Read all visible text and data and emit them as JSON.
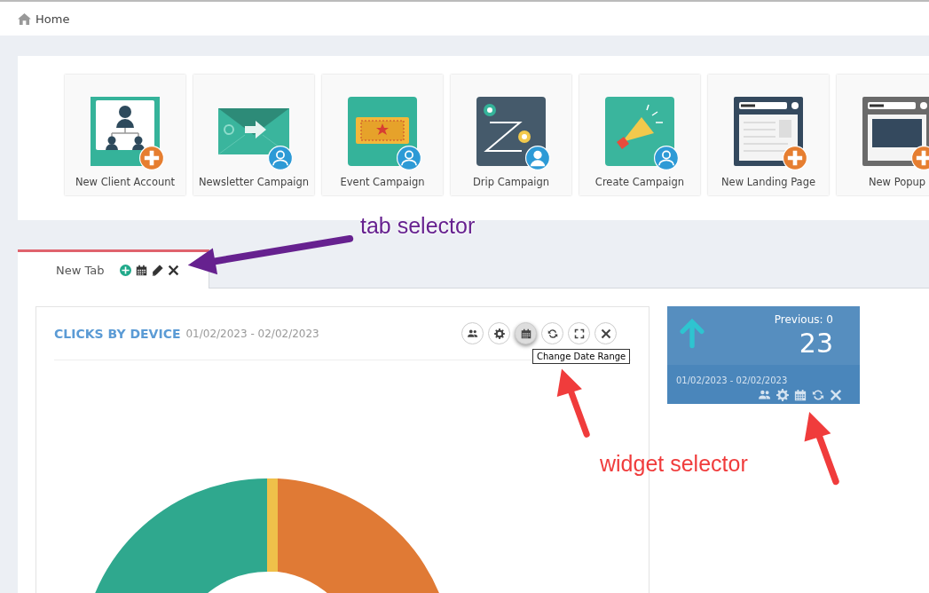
{
  "breadcrumb": {
    "label": "Home"
  },
  "shortcuts": [
    {
      "label": "New Client Account"
    },
    {
      "label": "Newsletter Campaign"
    },
    {
      "label": "Event Campaign"
    },
    {
      "label": "Drip Campaign"
    },
    {
      "label": "Create Campaign"
    },
    {
      "label": "New Landing Page"
    },
    {
      "label": "New Popup"
    }
  ],
  "tabs": [
    {
      "label": "New Tab",
      "selected": true
    }
  ],
  "chart_widget": {
    "title": "CLICKS BY DEVICE",
    "date_range": "01/02/2023 - 02/02/2023",
    "buttons": [
      {
        "kind": "users",
        "selected": false
      },
      {
        "kind": "settings",
        "selected": false
      },
      {
        "kind": "calendar",
        "selected": true
      },
      {
        "kind": "refresh",
        "selected": false
      },
      {
        "kind": "expand",
        "selected": false
      },
      {
        "kind": "close",
        "selected": false
      }
    ],
    "tooltip": "Change Date Range"
  },
  "stat_widget": {
    "previous": "Previous: 0",
    "value": "23",
    "date_range": "01/02/2023 - 02/02/2023"
  },
  "annotations": [
    {
      "text": "tab selector",
      "color": "#66218f"
    },
    {
      "text": "widget selector",
      "color": "#f03c3c"
    }
  ]
}
